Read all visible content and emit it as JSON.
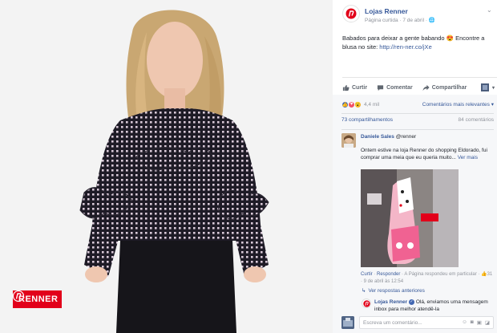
{
  "photo": {
    "brand_label": "RENNER"
  },
  "post": {
    "page_name": "Lojas Renner",
    "meta": "Página curtida · 7 de abril · ",
    "text": "Babados para deixar a gente babando 😍 Encontre a blusa no site: ",
    "link": "http://ren-ner.co/jXe"
  },
  "actions": {
    "like": "Curtir",
    "comment": "Comentar",
    "share": "Compartilhar"
  },
  "reactions": {
    "count": "4,4 mil",
    "sort": "Comentários mais relevantes ▾"
  },
  "stats": {
    "shares": "73 compartilhamentos",
    "comments": "84 comentários"
  },
  "comment": {
    "author": "Daniele Sales",
    "mention": "@renner",
    "text": "Ontem estive na loja Renner do shopping Eldorado, fui comprar uma meia que eu queria muito...",
    "see_more": "Ver mais",
    "like": "Curtir",
    "reply": "Responder",
    "meta_rest": " · A Página respondeu em particular · ",
    "reply_count": "31",
    "date": " · 9 de abril às 12:54"
  },
  "replies": {
    "link": "Ver respostas anteriores"
  },
  "reply": {
    "author": "Lojas Renner",
    "text": "Olá, enviamos uma mensagem inbox para melhor atendê-la"
  },
  "compose": {
    "placeholder": "Escreva um comentário..."
  },
  "colors": {
    "brand_red": "#e2001a",
    "fb_link": "#365899",
    "fb_blue": "#4267b2"
  }
}
